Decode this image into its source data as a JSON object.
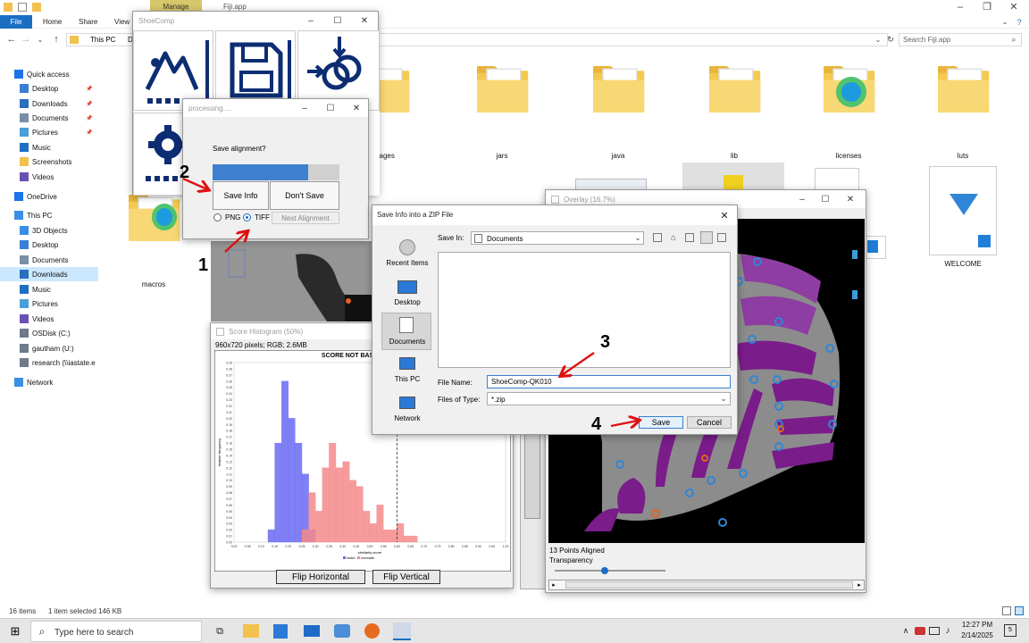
{
  "explorer": {
    "title": "Fiji.app",
    "manage_tab": "Manage",
    "ribbon_tabs": [
      "File",
      "Home",
      "Share",
      "View"
    ],
    "breadcrumb": [
      "This PC",
      "D"
    ],
    "search_placeholder": "Search Fiji.app",
    "nav": [
      {
        "label": "Quick access",
        "icon": "star-icon",
        "color": "#1a73e8"
      },
      {
        "label": "Desktop",
        "icon": "desktop-icon",
        "color": "#3a7fd5",
        "pinned": true
      },
      {
        "label": "Downloads",
        "icon": "download-icon",
        "color": "#2a6ebd",
        "pinned": true
      },
      {
        "label": "Documents",
        "icon": "documents-icon",
        "color": "#7a8fa6",
        "pinned": true
      },
      {
        "label": "Pictures",
        "icon": "pictures-icon",
        "color": "#4a9fd8",
        "pinned": true
      },
      {
        "label": "Music",
        "icon": "music-icon",
        "color": "#1e6fc2"
      },
      {
        "label": "Screenshots",
        "icon": "folder-icon",
        "color": "#f2c14e"
      },
      {
        "label": "Videos",
        "icon": "videos-icon",
        "color": "#6a52b3"
      },
      {
        "label": "OneDrive",
        "icon": "cloud-icon",
        "color": "#1a73e8"
      },
      {
        "label": "This PC",
        "icon": "computer-icon",
        "color": "#3a8ee6"
      },
      {
        "label": "3D Objects",
        "icon": "cube-icon",
        "color": "#3a8ee6"
      },
      {
        "label": "Desktop",
        "icon": "desktop-icon",
        "color": "#3a7fd5"
      },
      {
        "label": "Documents",
        "icon": "documents-icon",
        "color": "#7a8fa6"
      },
      {
        "label": "Downloads",
        "icon": "download-icon",
        "color": "#2a6ebd",
        "selected": true
      },
      {
        "label": "Music",
        "icon": "music-icon",
        "color": "#1e6fc2"
      },
      {
        "label": "Pictures",
        "icon": "pictures-icon",
        "color": "#4a9fd8"
      },
      {
        "label": "Videos",
        "icon": "videos-icon",
        "color": "#6a52b3"
      },
      {
        "label": "OSDisk (C:)",
        "icon": "drive-icon",
        "color": "#6d7b8a"
      },
      {
        "label": "gautham (U:)",
        "icon": "network-drive-icon",
        "color": "#6d7b8a"
      },
      {
        "label": "research (\\\\iastate.e",
        "icon": "network-drive-icon",
        "color": "#6d7b8a"
      },
      {
        "label": "Network",
        "icon": "network-icon",
        "color": "#3a8ee6"
      }
    ],
    "folders": [
      {
        "label": "images"
      },
      {
        "label": "jars"
      },
      {
        "label": "java"
      },
      {
        "label": "lib"
      },
      {
        "label": "licenses"
      },
      {
        "label": "luts"
      },
      {
        "label": "macros"
      }
    ],
    "welcome_label": "WELCOME",
    "status_left": "16 items",
    "status_selected": "1 item selected  146 KB"
  },
  "shoecomp": {
    "title": "ShoeComp"
  },
  "processing": {
    "title": "processing....",
    "question": "Save alignment?",
    "progress": 0.75,
    "save_info": "Save Info",
    "dont_save": "Don't Save",
    "png": "PNG",
    "tiff": "TIFF",
    "next": "Next Alignment"
  },
  "savezip": {
    "title": "Save Info into a ZIP File",
    "save_in_label": "Save In:",
    "save_in_value": "Documents",
    "places": [
      "Recent Items",
      "Desktop",
      "Documents",
      "This PC",
      "Network"
    ],
    "file_name_label": "File Name:",
    "file_name_value": "ShoeComp-QK010",
    "file_type_label": "Files of Type:",
    "file_type_value": "*.zip",
    "save": "Save",
    "cancel": "Cancel"
  },
  "histogram": {
    "title": "Score Histogram (50%)",
    "info": "960x720 pixels; RGB; 2.6MB",
    "banner": "SCORE NOT BASED ON RE",
    "flip_h": "Flip Horizontal",
    "flip_v": "Flip Vertical"
  },
  "overlay": {
    "title": "Overlay (16.7%)",
    "aligned": "13 Points Aligned",
    "transparency": "Transparency"
  },
  "annotations": [
    "1",
    "2",
    "3",
    "4"
  ],
  "taskbar": {
    "search": "Type here to search",
    "time": "12:27 PM",
    "date": "2/14/2025",
    "notif_count": "5"
  },
  "chart_data": {
    "type": "bar",
    "title": "SCORE NOT BASED ON RE",
    "xlabel": "similarity score",
    "ylabel": "relative frequency",
    "xticks": [
      "0.00",
      "0.05",
      "0.10",
      "0.15",
      "0.20",
      "0.25",
      "0.30",
      "0.35",
      "0.40",
      "0.45",
      "0.50",
      "0.55",
      "0.60",
      "0.65",
      "0.70",
      "0.75",
      "0.80",
      "0.85",
      "0.90",
      "0.95",
      "1.00"
    ],
    "yticks": [
      "0.00",
      "0.01",
      "0.02",
      "0.03",
      "0.04",
      "0.05",
      "0.06",
      "0.07",
      "0.08",
      "0.09",
      "0.10",
      "0.11",
      "0.12",
      "0.13",
      "0.14",
      "0.15",
      "0.16",
      "0.17",
      "0.18",
      "0.19",
      "0.20",
      "0.21",
      "0.22",
      "0.23",
      "0.24",
      "0.25",
      "0.26",
      "0.27",
      "0.28",
      "0.29"
    ],
    "ylim": [
      0,
      0.29
    ],
    "bin_width": 0.025,
    "series": [
      {
        "name": "match",
        "color": "#6a6af5",
        "bins": [
          0.125,
          0.15,
          0.175,
          0.2,
          0.225,
          0.25,
          0.275
        ],
        "values": [
          0.02,
          0.16,
          0.26,
          0.2,
          0.16,
          0.11,
          0.02
        ]
      },
      {
        "name": "nonmatch",
        "color": "#f58a8a",
        "bins": [
          0.25,
          0.275,
          0.3,
          0.325,
          0.35,
          0.375,
          0.4,
          0.425,
          0.45,
          0.475,
          0.5,
          0.525,
          0.55,
          0.575,
          0.6,
          0.625,
          0.65
        ],
        "values": [
          0.02,
          0.08,
          0.05,
          0.12,
          0.16,
          0.12,
          0.13,
          0.1,
          0.09,
          0.05,
          0.03,
          0.06,
          0.02,
          0.02,
          0.03,
          0.01,
          0.01
        ]
      }
    ],
    "vline": 0.6,
    "legend": [
      "match",
      "nonmatch"
    ]
  }
}
